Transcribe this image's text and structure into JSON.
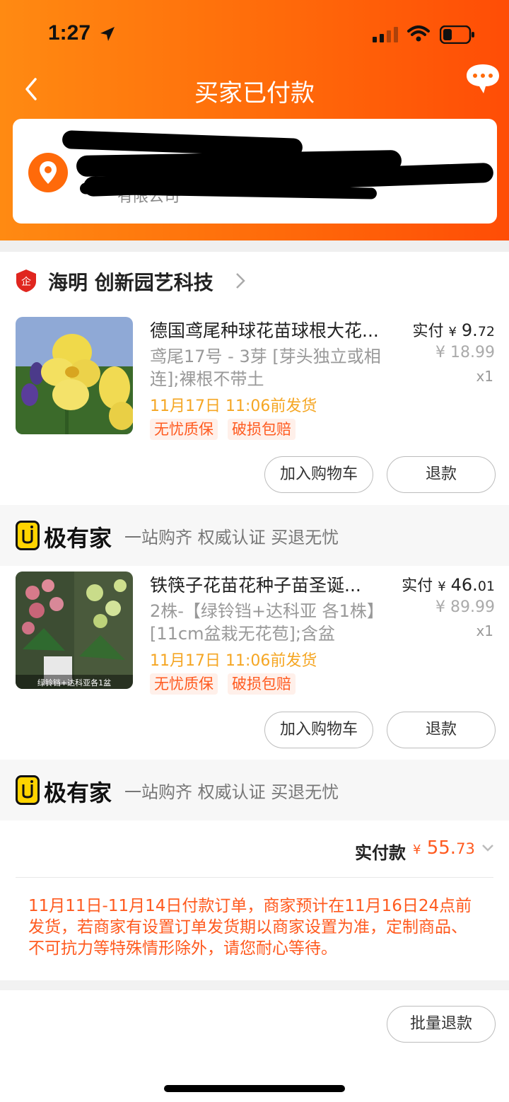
{
  "status": {
    "time": "1:27",
    "battery_level": 0.35
  },
  "nav": {
    "title": "买家已付款"
  },
  "address": {
    "company_partial": "有限公司"
  },
  "order": {
    "shop_name": "海明 创新园艺科技",
    "items": [
      {
        "title": "德国鸢尾种球花苗球根大花...",
        "sku": "鸢尾17号 - 3芽 [芽头独立或相连];裸根不带土",
        "ship_time": "11月17日 11:06前发货",
        "tags": [
          "无忧质保",
          "破损包赔"
        ],
        "paid_label": "实付",
        "paid_currency": "¥",
        "paid_int": "9.",
        "paid_dec": "72",
        "orig_price": "¥ 18.99",
        "qty": "x1",
        "add_cart_label": "加入购物车",
        "refund_label": "退款"
      },
      {
        "title": "铁筷子花苗花种子苗圣诞...",
        "sku": "2株-【绿铃铛+达科亚 各1株】[11cm盆栽无花苞];含盆",
        "ship_time": "11月17日 11:06前发货",
        "tags": [
          "无忧质保",
          "破损包赔"
        ],
        "thumb_caption": "绿铃铛+达科亚各1盆",
        "paid_label": "实付",
        "paid_currency": "¥",
        "paid_int": "46.",
        "paid_dec": "01",
        "orig_price": "¥ 89.99",
        "qty": "x1",
        "add_cart_label": "加入购物车",
        "refund_label": "退款"
      }
    ],
    "promo": {
      "logo": "极有家",
      "slogan": "一站购齐 权威认证 买退无忧"
    },
    "total": {
      "label": "实付款",
      "currency": "¥",
      "int": "55.",
      "dec": "73"
    },
    "notice": "11月11日-11月14日付款订单，商家预计在11月16日24点前发货，若商家有设置订单发货期以商家设置为准，定制商品、不可抗力等特殊情形除外，请您耐心等待。"
  },
  "footer": {
    "batch_refund_label": "批量退款"
  },
  "colors": {
    "brand_orange": "#ff6a0a",
    "accent_red": "#ff5a1f",
    "ship_yellow": "#f5a623"
  }
}
